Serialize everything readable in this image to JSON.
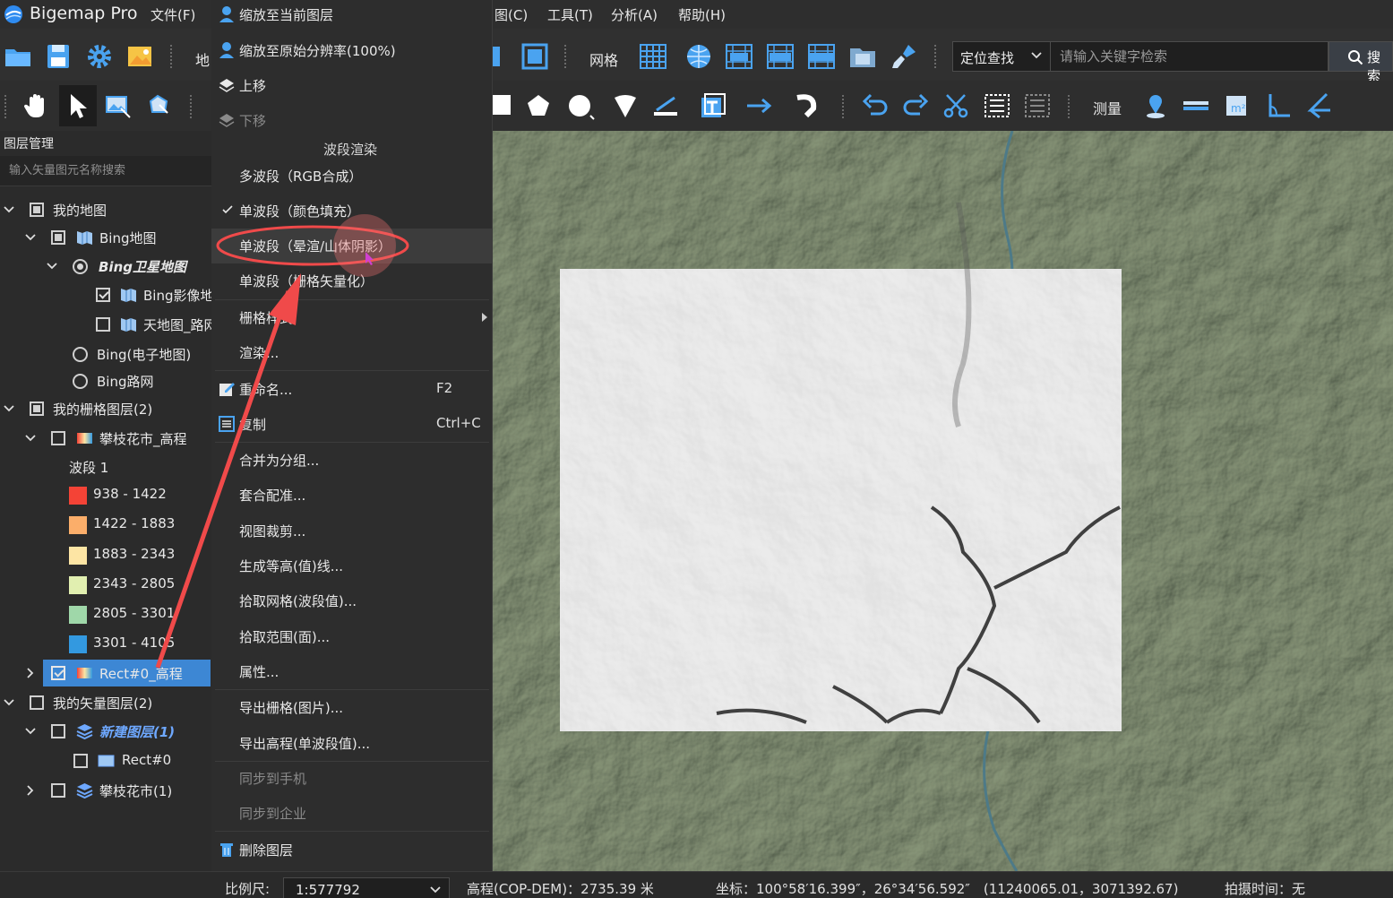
{
  "app": {
    "title": "Bigemap Pro"
  },
  "menubar": {
    "file": "文件(F)",
    "map_partial": "图(C)",
    "tools": "工具(T)",
    "analysis": "分析(A)",
    "help": "帮助(H)"
  },
  "toolbar": {
    "partial_label": "地",
    "grid_label": "网格",
    "measure_label": "测量",
    "locate_select": "定位查找",
    "search_placeholder": "请输入关键字检索",
    "search_button": "搜索"
  },
  "layer_panel": {
    "title": "图层管理",
    "search_placeholder": "输入矢量图元名称搜索",
    "rows": {
      "my_map": "我的地图",
      "bing_map": "Bing地图",
      "bing_satellite": "Bing卫星地图",
      "bing_image": "Bing影像地图",
      "tianditu": "天地图_路网",
      "bing_electronic": "Bing(电子地图)",
      "bing_road": "Bing路网",
      "my_raster": "我的栅格图层(2)",
      "panzhihua_dem": "攀枝花市_高程",
      "band": "波段 1",
      "rect_dem": "Rect#0_高程",
      "my_vector": "我的矢量图层(2)",
      "new_layer": "新建图层(1)",
      "rect0": "Rect#0",
      "panzhihua": "攀枝花市(1)"
    },
    "legend": [
      {
        "label": "938 - 1422",
        "color": "#f44336"
      },
      {
        "label": "1422 - 1883",
        "color": "#fbae6a"
      },
      {
        "label": "1883 - 2343",
        "color": "#fde5a4"
      },
      {
        "label": "2343 - 2805",
        "color": "#e1efb0"
      },
      {
        "label": "2805 - 3301",
        "color": "#9fd7a9"
      },
      {
        "label": "3301 - 4105",
        "color": "#3399e0"
      }
    ]
  },
  "context_menu": {
    "zoom_current": "缩放至当前图层",
    "zoom_original": "缩放至原始分辨率(100%)",
    "move_up": "上移",
    "move_down": "下移",
    "band_header": "波段渲染",
    "multi_band": "多波段（RGB合成）",
    "single_color": "单波段（颜色填充）",
    "single_hillshade": "单波段（晕渲/山体阴影）",
    "single_vector": "单波段（栅格矢量化）",
    "raster_style": "栅格样式",
    "render": "渲染...",
    "rename": "重命名...",
    "rename_shortcut": "F2",
    "copy": "复制",
    "copy_shortcut": "Ctrl+C",
    "merge_group": "合并为分组...",
    "registration": "套合配准...",
    "view_clip": "视图裁剪...",
    "contour": "生成等高(值)线...",
    "pick_grid": "拾取网格(波段值)...",
    "pick_range": "拾取范围(面)...",
    "properties": "属性...",
    "export_raster": "导出栅格(图片)...",
    "export_dem": "导出高程(单波段值)...",
    "sync_phone": "同步到手机",
    "sync_enterprise": "同步到企业",
    "delete_layer": "删除图层"
  },
  "statusbar": {
    "scale_label": "比例尺:",
    "scale_value": "1:577792",
    "elevation": "高程(COP-DEM)：2735.39 米",
    "coordinates": "坐标：100°58′16.399″，26°34′56.592″　(11240065.01，3071392.67)",
    "capture_time": "拍摄时间：无"
  },
  "colors": {
    "accent_selected": "#3d87d4",
    "annotation_red": "#f04a4a"
  }
}
